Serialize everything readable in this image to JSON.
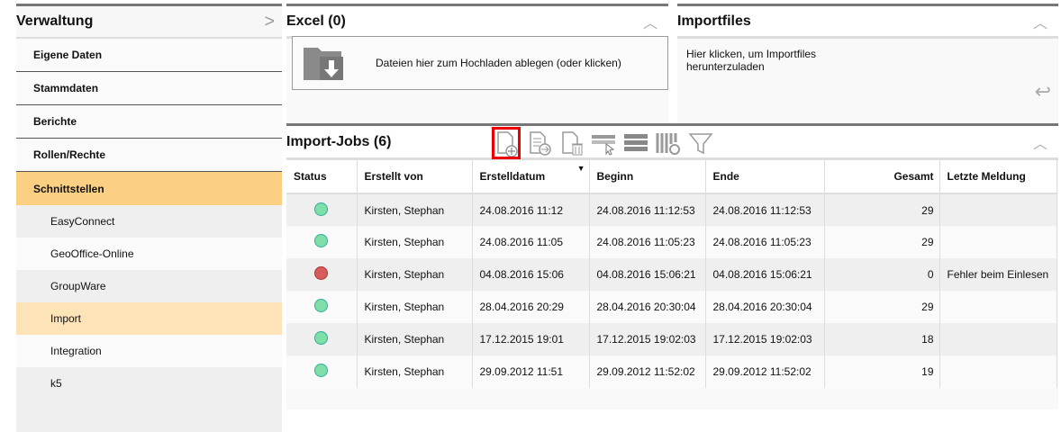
{
  "sidebar": {
    "title": "Verwaltung",
    "items": [
      "Eigene Daten",
      "Stammdaten",
      "Berichte",
      "Rollen/Rechte",
      "Schnittstellen"
    ],
    "subitems": [
      "EasyConnect",
      "GeoOffice-Online",
      "GroupWare",
      "Import",
      "Integration",
      "k5"
    ],
    "active": "Schnittstellen",
    "selected_sub": "Import"
  },
  "excel": {
    "title": "Excel (0)",
    "dropzone": "Dateien hier zum Hochladen ablegen (oder klicken)"
  },
  "importfiles": {
    "title": "Importfiles",
    "text_line1": "Hier klicken, um Importfiles",
    "text_line2": "herunterzuladen"
  },
  "jobs": {
    "title": "Import-Jobs (6)",
    "toolbar": [
      "new-file-icon",
      "file-export-icon",
      "file-delete-icon",
      "row-select-icon",
      "rows-icon",
      "column-settings-icon",
      "filter-icon"
    ],
    "columns": [
      "Status",
      "Erstellt von",
      "Erstelldatum",
      "Beginn",
      "Ende",
      "Gesamt",
      "Letzte Meldung"
    ],
    "sorted_column": "Erstelldatum",
    "rows": [
      {
        "status": "ok",
        "user": "Kirsten, Stephan",
        "created": "24.08.2016 11:12",
        "start": "24.08.2016 11:12:53",
        "end": "24.08.2016 11:12:53",
        "total": "29",
        "msg": ""
      },
      {
        "status": "ok",
        "user": "Kirsten, Stephan",
        "created": "24.08.2016 11:05",
        "start": "24.08.2016 11:05:23",
        "end": "24.08.2016 11:05:23",
        "total": "29",
        "msg": ""
      },
      {
        "status": "error",
        "user": "Kirsten, Stephan",
        "created": "04.08.2016 15:06",
        "start": "04.08.2016 15:06:21",
        "end": "04.08.2016 15:06:21",
        "total": "0",
        "msg": "Fehler beim Einlesen"
      },
      {
        "status": "ok",
        "user": "Kirsten, Stephan",
        "created": "28.04.2016 20:29",
        "start": "28.04.2016 20:30:04",
        "end": "28.04.2016 20:30:04",
        "total": "29",
        "msg": ""
      },
      {
        "status": "ok",
        "user": "Kirsten, Stephan",
        "created": "17.12.2015 19:01",
        "start": "17.12.2015 19:02:03",
        "end": "17.12.2015 19:02:03",
        "total": "18",
        "msg": ""
      },
      {
        "status": "ok",
        "user": "Kirsten, Stephan",
        "created": "29.09.2012 11:51",
        "start": "29.09.2012 11:52:02",
        "end": "29.09.2012 11:52:02",
        "total": "19",
        "msg": ""
      }
    ]
  },
  "colors": {
    "active": "#fcd083",
    "selected": "#fde3b8",
    "ok": "#7ee0a8",
    "error": "#d95c5c",
    "highlight": "#e00000"
  }
}
